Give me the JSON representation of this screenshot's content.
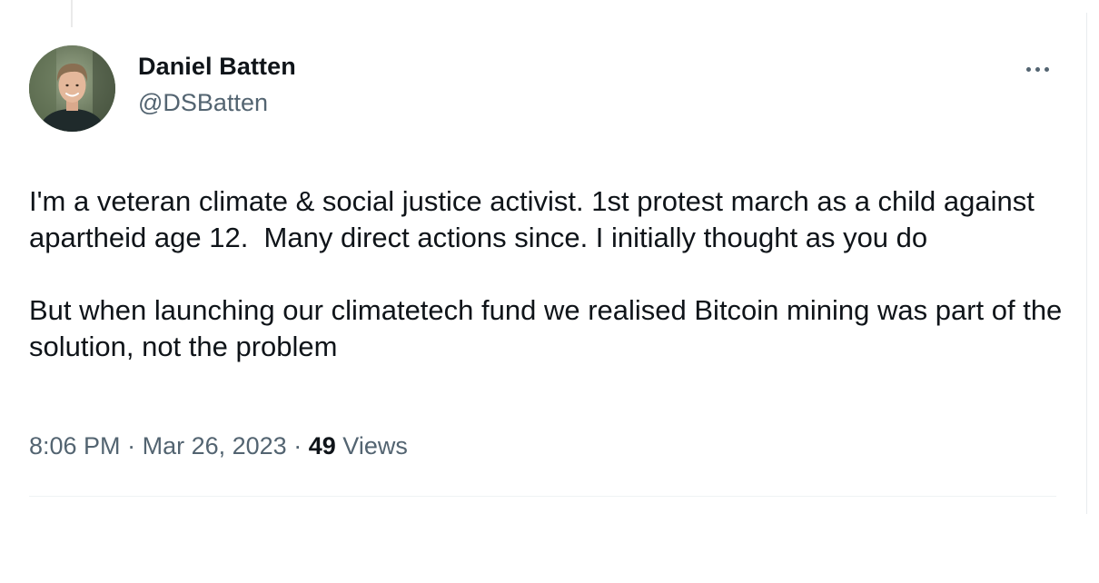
{
  "author": {
    "display_name": "Daniel Batten",
    "handle": "@DSBatten"
  },
  "tweet": {
    "text": "I'm a veteran climate & social justice activist. 1st protest march as a child against apartheid age 12.  Many direct actions since. I initially thought as you do\n\nBut when launching our climatetech fund we realised Bitcoin mining was part of the solution, not the problem",
    "time": "8:06 PM",
    "separator": "·",
    "date": "Mar 26, 2023",
    "views_count": "49",
    "views_label": "Views"
  },
  "icons": {
    "more": "more-horizontal-icon",
    "avatar": "profile-photo"
  },
  "colors": {
    "primary_text": "#0f1419",
    "secondary_text": "#536471",
    "divider": "#eff3f4"
  }
}
